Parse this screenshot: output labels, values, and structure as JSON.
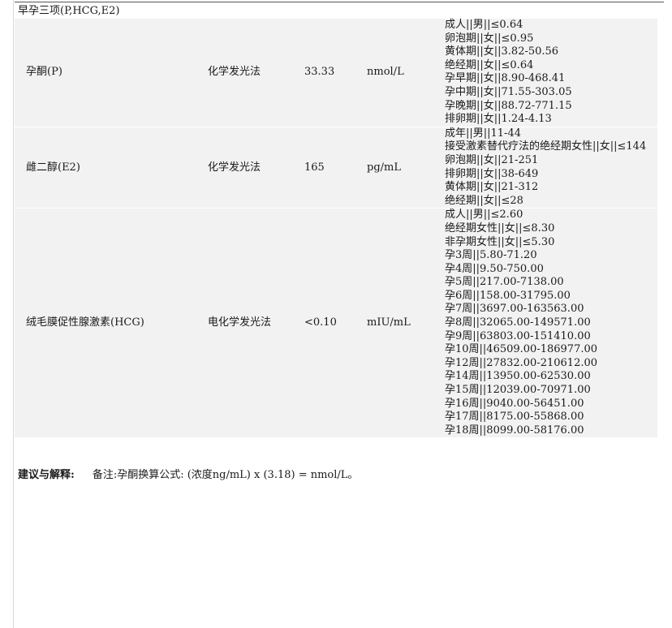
{
  "section_title": "早孕三项(P,HCG,E2)",
  "tests": [
    {
      "name": "孕酮(P)",
      "method": "化学发光法",
      "value": "33.33",
      "unit": "nmol/L",
      "reference": [
        "成人||男||≤0.64",
        "卵泡期||女||≤0.95",
        "黄体期||女||3.82-50.56",
        "绝经期||女||≤0.64",
        "孕早期||女||8.90-468.41",
        "孕中期||女||71.55-303.05",
        "孕晚期||女||88.72-771.15",
        "排卵期||女||1.24-4.13"
      ]
    },
    {
      "name": "雌二醇(E2)",
      "method": "化学发光法",
      "value": "165",
      "unit": "pg/mL",
      "reference": [
        "成年||男||11-44",
        "接受激素替代疗法的绝经期女性||女||≤144",
        "卵泡期||女||21-251",
        "排卵期||女||38-649",
        "黄体期||女||21-312",
        "绝经期||女||≤28"
      ]
    },
    {
      "name": "绒毛膜促性腺激素(HCG)",
      "method": "电化学发光法",
      "value": "<0.10",
      "unit": "mIU/mL",
      "reference": [
        "成人||男||≤2.60",
        "绝经期女性||女||≤8.30",
        "非孕期女性||女||≤5.30",
        "孕3周||5.80-71.20",
        "孕4周||9.50-750.00",
        "孕5周||217.00-7138.00",
        "孕6周||158.00-31795.00",
        "孕7周||3697.00-163563.00",
        "孕8周||32065.00-149571.00",
        "孕9周||63803.00-151410.00",
        "孕10周||46509.00-186977.00",
        "孕12周||27832.00-210612.00",
        "孕14周||13950.00-62530.00",
        "孕15周||12039.00-70971.00",
        "孕16周||9040.00-56451.00",
        "孕17周||8175.00-55868.00",
        "孕18周||8099.00-58176.00"
      ]
    }
  ],
  "advice": {
    "label": "建议与解释:",
    "text": "备注:孕酮换算公式: (浓度ng/mL) x (3.18) = nmol/L。"
  }
}
